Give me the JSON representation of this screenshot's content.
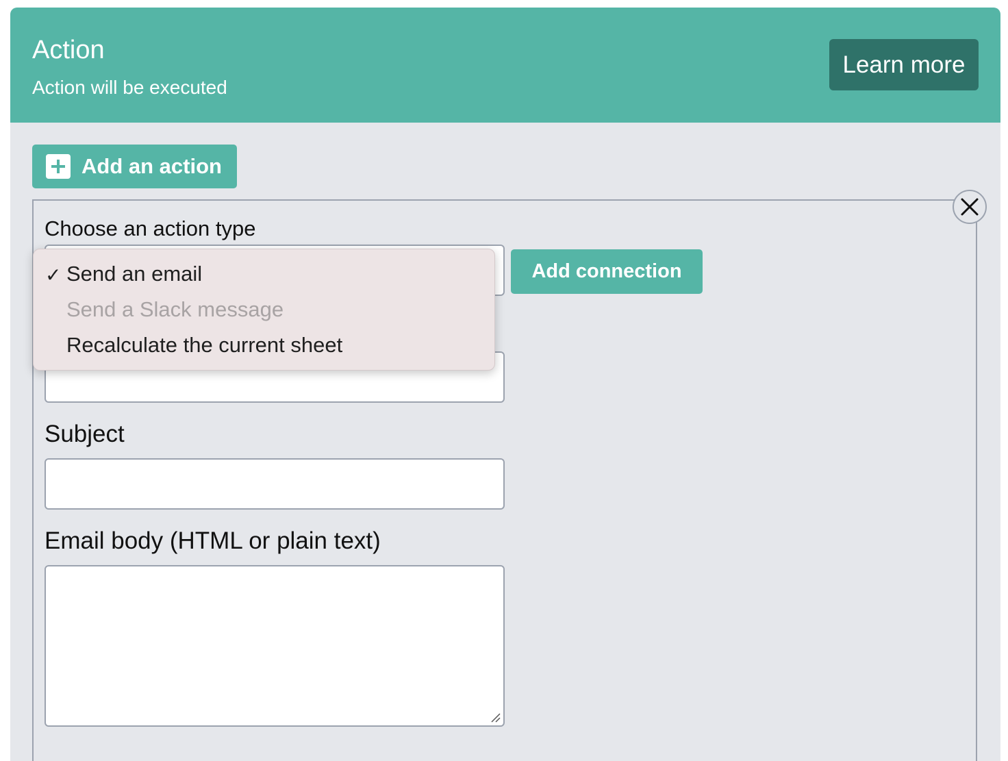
{
  "header": {
    "title": "Action",
    "subtitle": "Action will be executed",
    "learn_more_label": "Learn more"
  },
  "add_action": {
    "label": "Add an action",
    "icon": "plus-square-icon"
  },
  "action_form": {
    "close_icon": "close-icon",
    "action_type_label": "Choose an action type",
    "add_connection_label": "Add connection",
    "dropdown": {
      "options": [
        {
          "label": "Send an email",
          "selected": true,
          "disabled": false
        },
        {
          "label": "Send a Slack message",
          "selected": false,
          "disabled": true
        },
        {
          "label": "Recalculate the current sheet",
          "selected": false,
          "disabled": false
        }
      ],
      "check_mark": "✓"
    },
    "subject_label": "Subject",
    "subject_value": "",
    "email_body_label": "Email body (HTML or plain text)",
    "email_body_value": ""
  },
  "colors": {
    "accent": "#55b5a6",
    "accent_dark": "#2f7269",
    "panel_background": "#e5e7eb",
    "dropdown_background": "#ede4e5"
  }
}
